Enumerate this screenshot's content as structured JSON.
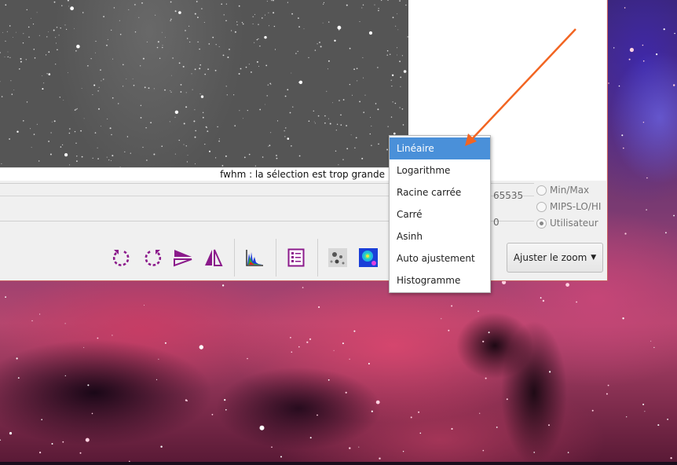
{
  "status": {
    "fwhm_message": "fwhm : la sélection est trop grande"
  },
  "display_range": {
    "max_value": "65535",
    "min_value": "0"
  },
  "cutoff_modes": [
    {
      "label": "Min/Max",
      "checked": false
    },
    {
      "label": "MIPS-LO/HI",
      "checked": false
    },
    {
      "label": "Utilisateur",
      "checked": true
    }
  ],
  "toolbar": {
    "buttons": [
      {
        "icon": "rotate-left-icon"
      },
      {
        "icon": "rotate-right-icon"
      },
      {
        "icon": "mirror-horizontal-icon"
      },
      {
        "icon": "mirror-vertical-icon"
      },
      {
        "icon": "histogram-icon"
      },
      {
        "icon": "list-icon"
      },
      {
        "icon": "grayscale-preview-icon"
      },
      {
        "icon": "color-preview-icon"
      }
    ],
    "zoom_label": "Ajuster le zoom"
  },
  "scale_menu": {
    "items": [
      {
        "label": "Linéaire",
        "selected": true
      },
      {
        "label": "Logarithme",
        "selected": false
      },
      {
        "label": "Racine carrée",
        "selected": false
      },
      {
        "label": "Carré",
        "selected": false
      },
      {
        "label": "Asinh",
        "selected": false
      },
      {
        "label": "Auto ajustement",
        "selected": false
      },
      {
        "label": "Histogramme",
        "selected": false
      }
    ]
  },
  "colors": {
    "accent": "#4a90d9",
    "icon_purple": "#8b1a8b",
    "arrow": "#f26522"
  }
}
